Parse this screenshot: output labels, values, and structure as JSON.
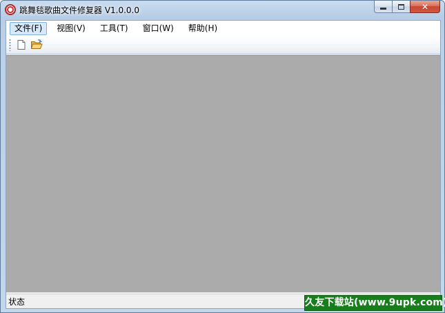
{
  "window": {
    "title": "跳舞毯歌曲文件修复器 V1.0.0.0",
    "icon": "dance-mat-app-icon"
  },
  "menu": {
    "items": [
      {
        "label": "文件(F)",
        "active": true
      },
      {
        "label": "视图(V)",
        "active": false
      },
      {
        "label": "工具(T)",
        "active": false
      },
      {
        "label": "窗口(W)",
        "active": false
      },
      {
        "label": "帮助(H)",
        "active": false
      }
    ]
  },
  "toolbar": {
    "buttons": [
      {
        "icon": "new-file-icon"
      },
      {
        "icon": "open-folder-icon"
      }
    ]
  },
  "status": {
    "text": "状态"
  },
  "watermark": {
    "text": "久友下载站(www.9upk.com)"
  },
  "colors": {
    "workspace": "#ababab",
    "watermark_bg": "#177d1d",
    "menu_highlight": "#d6e8fa"
  }
}
